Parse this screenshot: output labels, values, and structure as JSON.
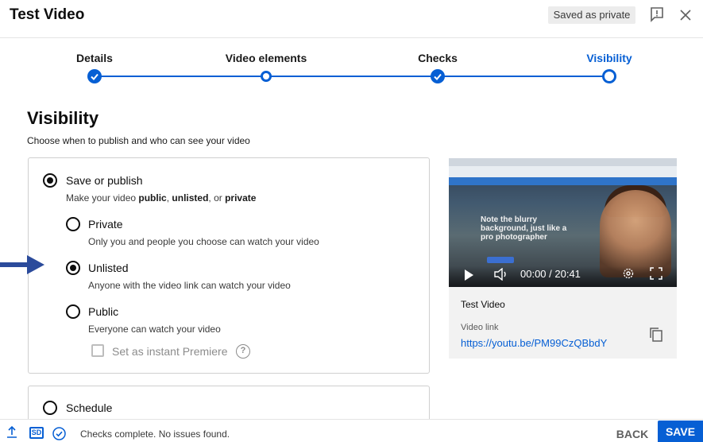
{
  "header": {
    "title": "Test Video",
    "saved_status": "Saved as private"
  },
  "stepper": {
    "steps": [
      {
        "label": "Details",
        "state": "done"
      },
      {
        "label": "Video elements",
        "state": "open"
      },
      {
        "label": "Checks",
        "state": "done"
      },
      {
        "label": "Visibility",
        "state": "current"
      }
    ]
  },
  "visibility": {
    "title": "Visibility",
    "subtitle": "Choose when to publish and who can see your video",
    "save_or_publish": {
      "label": "Save or publish",
      "desc_prefix": "Make your video ",
      "desc_public": "public",
      "desc_sep1": ", ",
      "desc_unlisted": "unlisted",
      "desc_sep2": ", or ",
      "desc_private": "private",
      "selected": true
    },
    "options": [
      {
        "label": "Private",
        "desc": "Only you and people you choose can watch your video",
        "selected": false
      },
      {
        "label": "Unlisted",
        "desc": "Anyone with the video link can watch your video",
        "selected": true
      },
      {
        "label": "Public",
        "desc": "Everyone can watch your video",
        "selected": false
      }
    ],
    "premiere": {
      "label": "Set as instant Premiere",
      "checked": false
    },
    "schedule": {
      "label": "Schedule",
      "selected": false
    }
  },
  "preview": {
    "overlay_text": "Note the blurry background, just like a pro photographer",
    "time": "00:00 / 20:41",
    "video_title": "Test Video",
    "link_label": "Video link",
    "link_url": "https://youtu.be/PM99CzQBbdY"
  },
  "footer": {
    "status": "Checks complete. No issues found.",
    "sd_label": "SD",
    "back_label": "BACK",
    "save_label": "SAVE"
  },
  "colors": {
    "accent": "#065fd4",
    "annotation_arrow": "#2b4b9b"
  }
}
